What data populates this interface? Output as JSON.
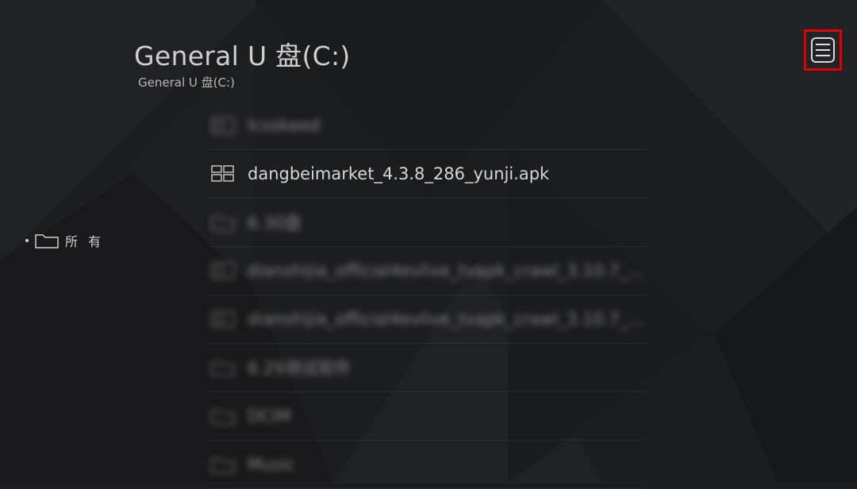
{
  "header": {
    "title": "General U 盘(C:)",
    "breadcrumb": "General U 盘(C:)"
  },
  "menu_button": {
    "icon": "menu-icon",
    "highlight_color": "#e00000"
  },
  "sidebar": {
    "items": [
      {
        "label": "所 有",
        "icon": "folder-icon",
        "selected": true
      }
    ]
  },
  "files": [
    {
      "name": "lcsokeed",
      "icon": "document-icon",
      "blurred": true
    },
    {
      "name": "dangbeimarket_4.3.8_286_yunji.apk",
      "icon": "apk-icon",
      "blurred": false
    },
    {
      "name": "6.30盘",
      "icon": "folder-icon",
      "blurred": true
    },
    {
      "name": "dianshijia_official4evlive_tvapk_crawl_3.10.7_...",
      "icon": "document-icon",
      "blurred": true
    },
    {
      "name": "dianshijia_official4evlive_tvapk_crawl_3.10.7_...",
      "icon": "document-icon",
      "blurred": true
    },
    {
      "name": "6.29测试软件",
      "icon": "folder-icon",
      "blurred": true
    },
    {
      "name": "DCIM",
      "icon": "folder-icon",
      "blurred": true
    },
    {
      "name": "Music",
      "icon": "folder-icon",
      "blurred": true
    }
  ],
  "colors": {
    "background": "#1c1d1f",
    "text": "#d8d8d8",
    "accent": "#e00000"
  }
}
